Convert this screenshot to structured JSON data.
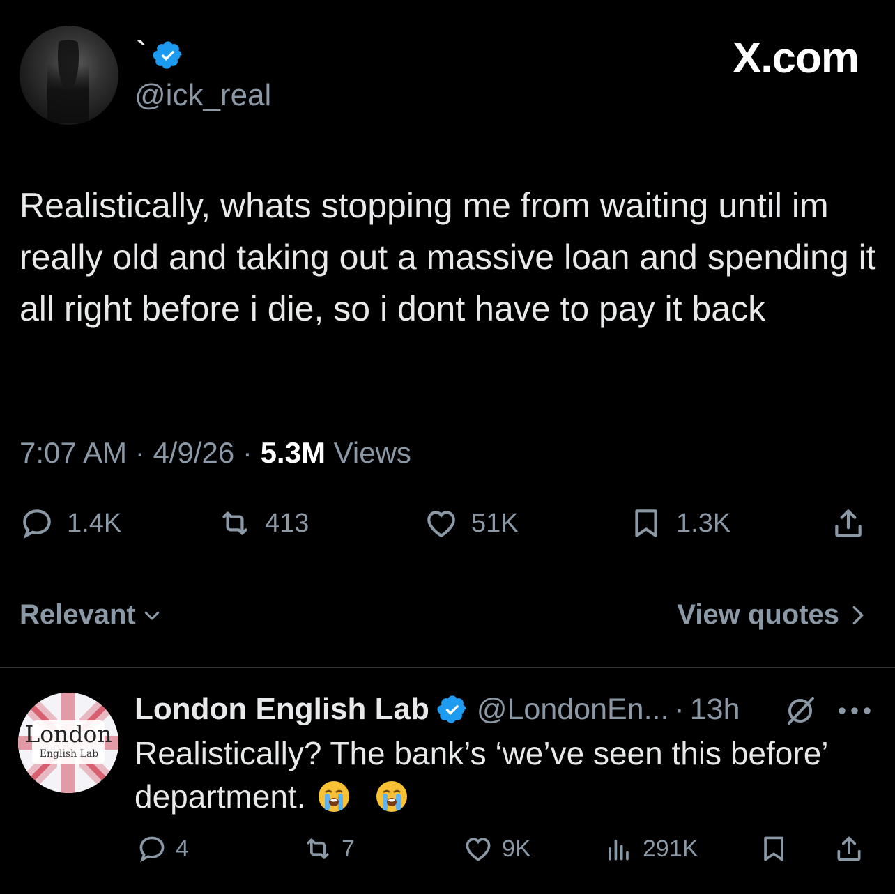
{
  "tweet": {
    "display_name": "`",
    "handle": "@ick_real",
    "brand": "X.com",
    "text": "Realistically, whats stopping me from waiting until im really old and taking out a massive loan and spending it all right before i die, so i dont have to pay it back",
    "time": "7:07 AM",
    "date": "4/9/26",
    "separator": "·",
    "views_count": "5.3M",
    "views_label": "Views",
    "replies": "1.4K",
    "reposts": "413",
    "likes": "51K",
    "bookmarks": "1.3K",
    "icons": [
      "reply-icon",
      "repost-icon",
      "like-icon",
      "bookmark-icon",
      "share-icon",
      "verified-badge-icon"
    ]
  },
  "filters": {
    "sort_label": "Relevant",
    "view_quotes_label": "View quotes"
  },
  "reply": {
    "avatar_title": "London",
    "avatar_subtitle": "English Lab",
    "display_name": "London English Lab",
    "handle": "@LondonEn...",
    "separator": "·",
    "time": "13h",
    "text": "Realistically? The bank’s ‘we’ve seen this before’ department.",
    "replies": "4",
    "reposts": "7",
    "likes": "9K",
    "views": "291K",
    "icons": [
      "reply-icon",
      "repost-icon",
      "like-icon",
      "analytics-icon",
      "bookmark-icon",
      "share-icon",
      "grok-icon",
      "more-icon",
      "loudly-crying-face-emoji"
    ]
  },
  "colors": {
    "background": "#000000",
    "text_primary": "#e7e9ea",
    "text_secondary": "#8b98a5",
    "verified_blue": "#1d9bf0",
    "divider": "#2f3336"
  }
}
